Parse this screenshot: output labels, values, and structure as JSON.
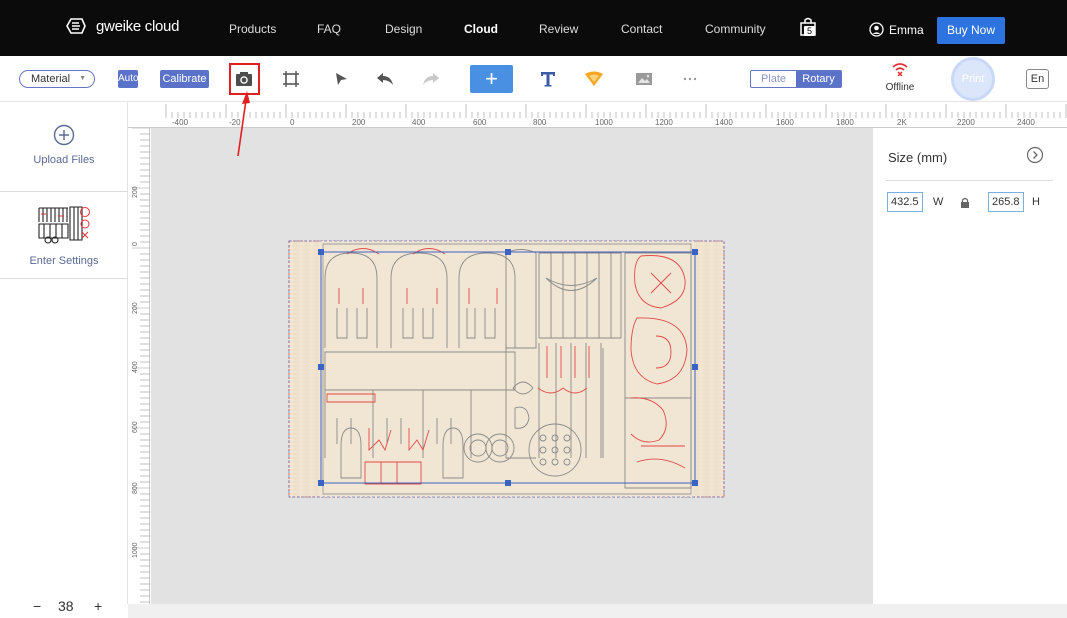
{
  "nav": {
    "logo_text": "gweike cloud",
    "items": [
      "Products",
      "FAQ",
      "Design",
      "Cloud",
      "Review",
      "Contact",
      "Community"
    ],
    "active": "Cloud",
    "bag_count": "5",
    "user_name": "Emma",
    "buy_label": "Buy Now"
  },
  "toolbar": {
    "material_label": "Material",
    "auto_label": "Auto",
    "calibrate_label": "Calibrate",
    "icons": [
      "camera-icon",
      "frame-icon",
      "select-arrow-icon",
      "undo-icon",
      "redo-icon",
      "add-icon",
      "text-icon",
      "shape-icon",
      "image-icon",
      "more-icon"
    ],
    "mode_options": [
      "Plate",
      "Rotary"
    ],
    "mode_selected": "Rotary",
    "status_label": "Offline",
    "print_label": "Print",
    "lang_label": "En",
    "highlight_color": "#e02020",
    "accent_color": "#5b72c9"
  },
  "left_panel": {
    "upload_label": "Upload Files",
    "settings_label": "Enter Settings"
  },
  "rulers": {
    "top_ticks": [
      "-400",
      "-20",
      "0",
      "200",
      "400",
      "600",
      "800",
      "1000",
      "1200",
      "1400",
      "1600",
      "1800",
      "2K",
      "2200",
      "2400"
    ],
    "left_ticks": [
      "200",
      "0",
      "200",
      "400",
      "600",
      "800",
      "1000"
    ]
  },
  "zoom": {
    "minus": "−",
    "value": "38",
    "plus": "+"
  },
  "size_panel": {
    "title": "Size (mm)",
    "width_value": "432.5",
    "width_unit": "W",
    "height_value": "265.8",
    "height_unit": "H"
  }
}
